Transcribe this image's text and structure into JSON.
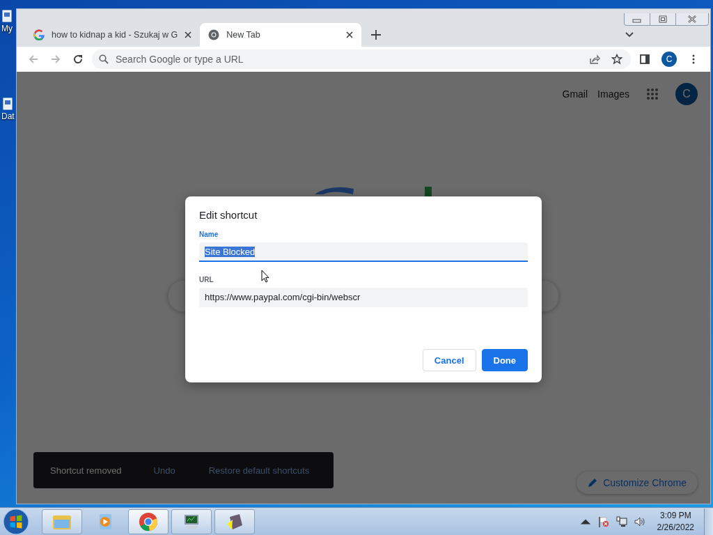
{
  "desktop": {
    "icons": [
      {
        "label": "My"
      },
      {
        "label": "Dat"
      }
    ]
  },
  "browser": {
    "tabs": [
      {
        "title": "how to kidnap a kid - Szukaj w G",
        "kind": "google",
        "selected": false
      },
      {
        "title": "New Tab",
        "kind": "chrome",
        "selected": true
      }
    ],
    "omnibox": {
      "placeholder": "Search Google or type a URL"
    },
    "profile_initial": "C"
  },
  "page": {
    "header_links": [
      "Gmail",
      "Images"
    ],
    "avatar_initial": "C",
    "snackbar": {
      "message": "Shortcut removed",
      "actions": [
        "Undo",
        "Restore default shortcuts"
      ]
    },
    "customize_button": "Customize Chrome"
  },
  "dialog": {
    "title": "Edit shortcut",
    "fields": [
      {
        "label": "Name",
        "value": "Site Blocked",
        "focused": true,
        "text_selected": true
      },
      {
        "label": "URL",
        "value": "https://www.paypal.com/cgi-bin/webscr",
        "focused": false,
        "text_selected": false
      }
    ],
    "buttons": [
      {
        "label": "Cancel",
        "kind": "secondary"
      },
      {
        "label": "Done",
        "kind": "primary"
      }
    ]
  },
  "taskbar": {
    "clock": {
      "time": "3:09 PM",
      "date": "2/26/2022"
    }
  }
}
